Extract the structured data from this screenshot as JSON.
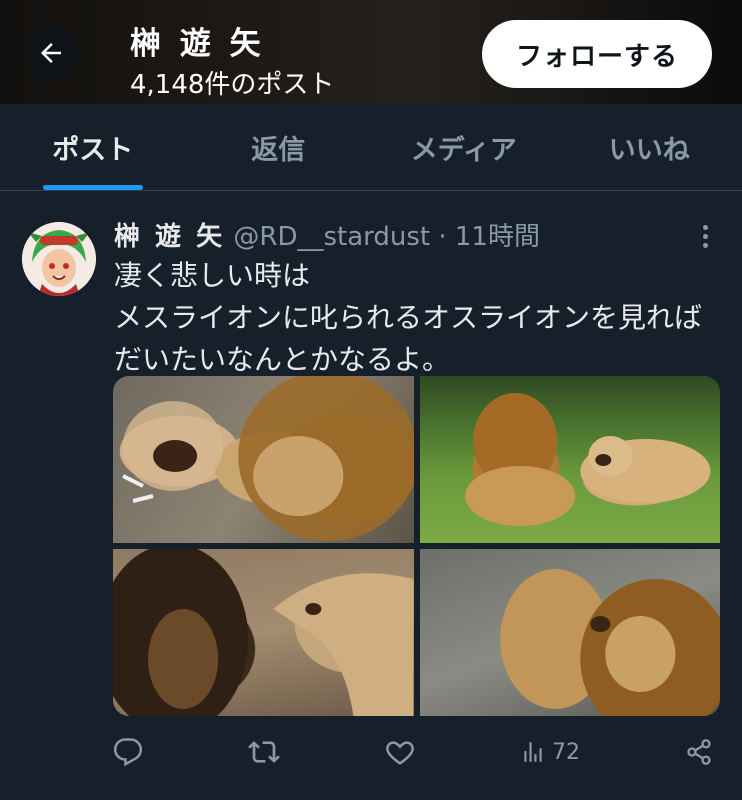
{
  "header": {
    "title": "榊 遊 矢",
    "post_count": "4,148件のポスト",
    "follow_label": "フォローする",
    "back_icon": "arrow-left-icon"
  },
  "tabs": [
    {
      "label": "ポスト",
      "active": true
    },
    {
      "label": "返信",
      "active": false
    },
    {
      "label": "メディア",
      "active": false
    },
    {
      "label": "いいね",
      "active": false
    }
  ],
  "post": {
    "display_name": "榊 遊 矢",
    "handle": "@RD__stardust",
    "separator": " · ",
    "time": "11時間",
    "text_lines": [
      "凄く悲しい時は",
      "メスライオンに叱られるオスライオンを見れば",
      "だいたいなんとかなるよ。"
    ],
    "media": [
      {
        "icon": "photo-lions-fighting"
      },
      {
        "icon": "photo-lions-on-grass"
      },
      {
        "icon": "photo-lioness-roaring-at-lion"
      },
      {
        "icon": "photo-lions-snarling"
      }
    ],
    "actions": {
      "reply_icon": "reply-icon",
      "repost_icon": "repost-icon",
      "like_icon": "heart-icon",
      "views_icon": "analytics-icon",
      "views_count": "72",
      "share_icon": "share-icon"
    }
  },
  "colors": {
    "background": "#15202b",
    "accent": "#1d9bf0",
    "muted_text": "#8b98a5",
    "text": "#e7e9ea"
  }
}
